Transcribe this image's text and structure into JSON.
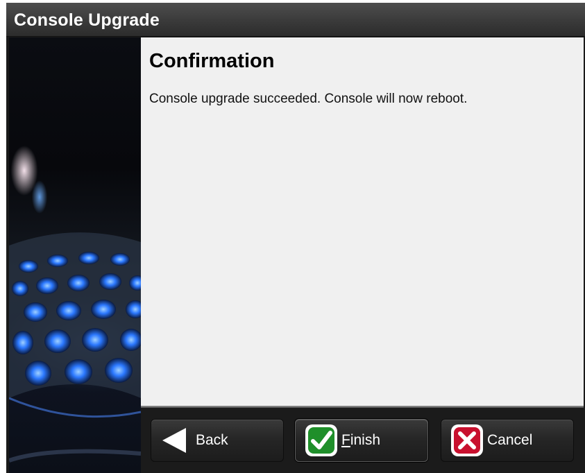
{
  "window": {
    "title": "Console Upgrade"
  },
  "content": {
    "heading": "Confirmation",
    "message": "Console upgrade succeeded. Console will now reboot."
  },
  "buttons": {
    "back": {
      "label": "Back",
      "icon": "back-arrow-icon"
    },
    "finish": {
      "mnemonic": "F",
      "label_rest": "inish",
      "icon": "checkmark-icon"
    },
    "cancel": {
      "label": "Cancel",
      "icon": "close-x-icon"
    }
  },
  "colors": {
    "finish_icon": "#1f8f2a",
    "cancel_icon": "#c8102e",
    "content_bg": "#f0f0f0",
    "titlebar_bg": "#3a3a3a"
  }
}
